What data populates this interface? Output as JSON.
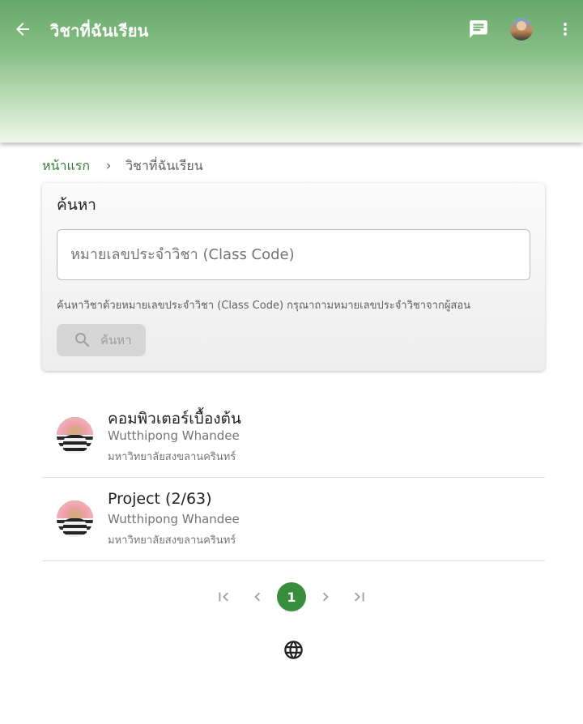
{
  "appbar": {
    "title": "วิชาที่ฉันเรียน",
    "icons": [
      "arrow-left-icon",
      "chat-icon",
      "avatar",
      "more-vert-icon"
    ]
  },
  "breadcrumb": {
    "home": "หน้าแรก",
    "current": "วิชาที่ฉันเรียน"
  },
  "search": {
    "title": "ค้นหา",
    "placeholder": "หมายเลขประจำวิชา (Class Code)",
    "value": "",
    "hint": "ค้นหาวิชาด้วยหมายเลขประจำวิชา (Class Code) กรุณาถามหมายเลขประจำวิชาจากผู้สอน",
    "button_label": "ค้นหา"
  },
  "classes": [
    {
      "name": "คอมพิวเตอร์เบื้องต้น",
      "owner": "Wutthipong Whandee",
      "school": "มหาวิทยาลัยสงขลานครินทร์"
    },
    {
      "name": "Project (2/63)",
      "owner": "Wutthipong Whandee",
      "school": "มหาวิทยาลัยสงขลานครินทร์"
    }
  ],
  "pagination": {
    "current_page": "1"
  },
  "colors": {
    "primary": "#388e3c",
    "appbar_top": "#66a96a",
    "breadcrumb_link": "#3f7f3f"
  }
}
